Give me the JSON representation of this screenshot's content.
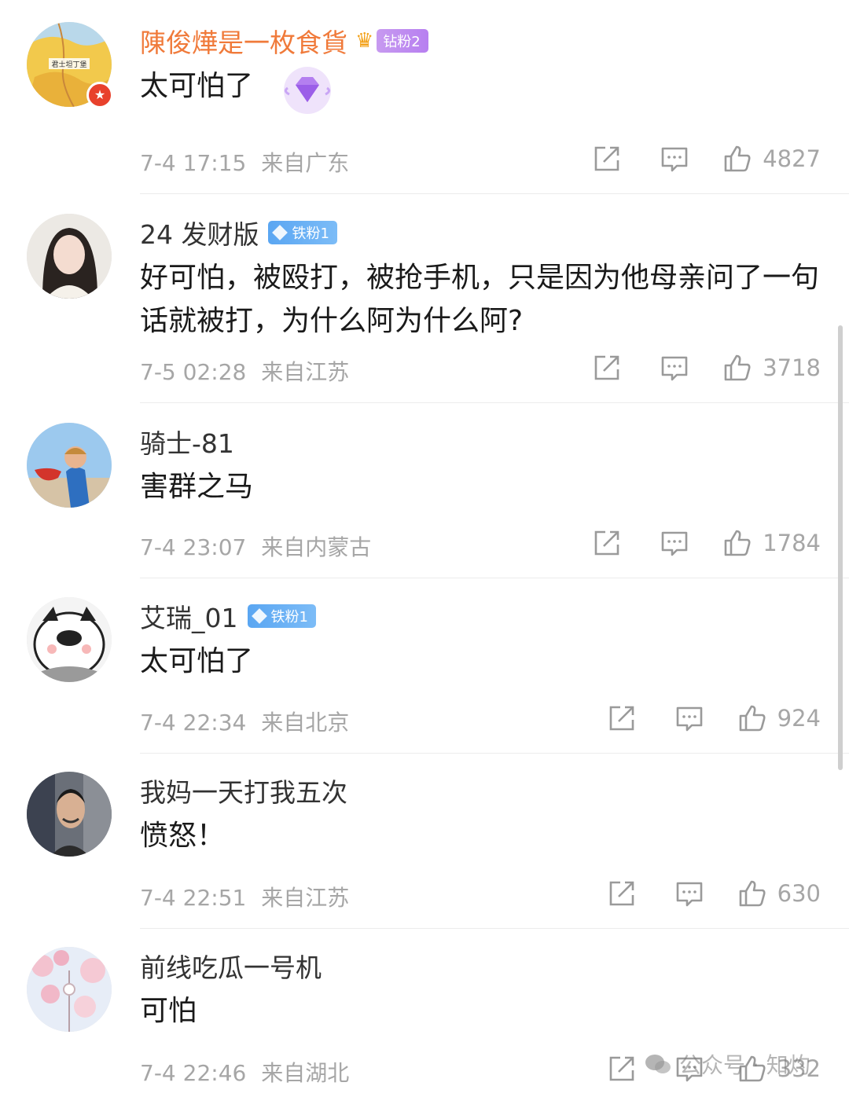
{
  "comments": [
    {
      "username": "陳俊燁是一枚食貨",
      "badge": "钻粉2",
      "text": "太可怕了",
      "time": "7-4 17:15",
      "location": "来自广东",
      "likes": "4827"
    },
    {
      "username": "24 发财版",
      "badge": "铁粉1",
      "text": "好可怕，被殴打，被抢手机，只是因为他母亲问了一句话就被打，为什么阿为什么阿?",
      "time": "7-5 02:28",
      "location": "来自江苏",
      "likes": "3718"
    },
    {
      "username": "骑士-81",
      "text": "害群之马",
      "time": "7-4 23:07",
      "location": "来自内蒙古",
      "likes": "1784"
    },
    {
      "username": "艾瑞_01",
      "badge": "铁粉1",
      "text": "太可怕了",
      "time": "7-4 22:34",
      "location": "来自北京",
      "likes": "924"
    },
    {
      "username": "我妈一天打我五次",
      "text": "愤怒！",
      "time": "7-4 22:51",
      "location": "来自江苏",
      "likes": "630"
    },
    {
      "username": "前线吃瓜一号机",
      "text": "可怕",
      "time": "7-4 22:46",
      "location": "来自湖北",
      "likes": "332"
    }
  ],
  "avatar_map_label": "君士坦丁堡",
  "watermark": "公众号 · 知灼",
  "icons": {
    "share": "share-icon",
    "comment": "comment-icon",
    "like": "thumbs-up-icon",
    "crown": "crown-icon",
    "gem": "gem-icon"
  },
  "colors": {
    "vip_name": "#f07a3a",
    "meta_gray": "#a6a6a6",
    "iron_badge": "#5aa6f2",
    "drill_badge": "#b77ff0"
  }
}
